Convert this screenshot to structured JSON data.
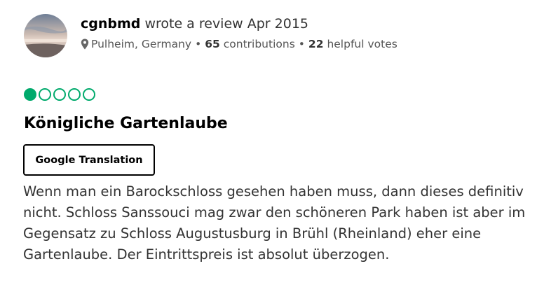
{
  "review": {
    "author": {
      "username": "cgnbmd",
      "action_text": "wrote a review Apr 2015",
      "avatar_icon": "user-avatar-photo",
      "location": "Pulheim, Germany",
      "contributions_count": "65",
      "contributions_label": "contributions",
      "helpful_votes_count": "22",
      "helpful_votes_label": "helpful votes",
      "separator": "•"
    },
    "rating": {
      "value": 1,
      "max": 5,
      "color": "#00aa6c",
      "icon": "rating-bubble-icon"
    },
    "title": "Königliche Gartenlaube",
    "translate_button_label": "Google Translation",
    "text": "Wenn man ein Barockschloss gesehen haben muss, dann dieses definitiv nicht. Schloss Sanssouci mag zwar den schöneren Park haben ist aber im Gegensatz zu Schloss Augustusburg in Brühl (Rheinland) eher eine Gartenlaube. Der Eintrittspreis ist absolut überzogen."
  }
}
